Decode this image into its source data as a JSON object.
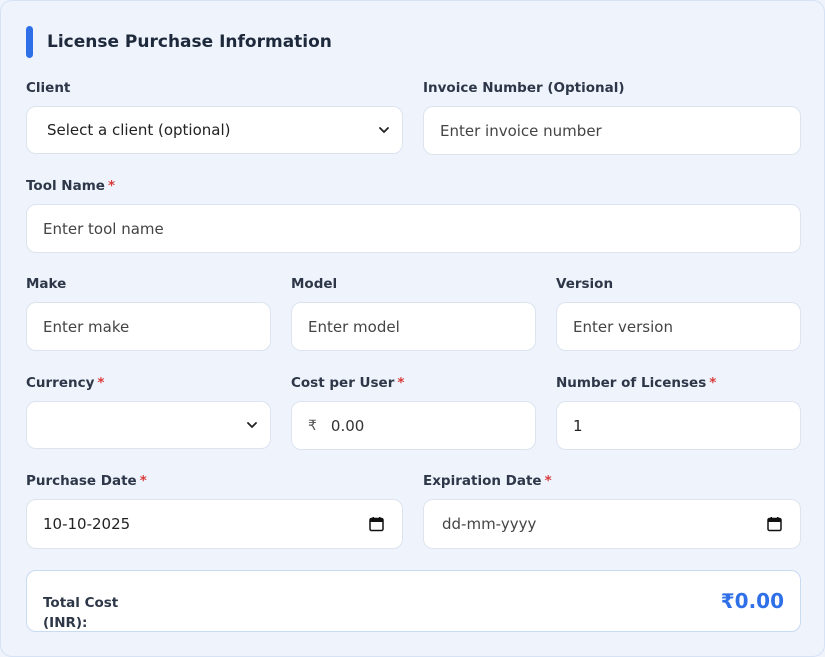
{
  "section": {
    "title": "License Purchase Information"
  },
  "client": {
    "label": "Client",
    "value": "Select a client (optional)"
  },
  "invoice": {
    "label": "Invoice Number (Optional)",
    "placeholder": "Enter invoice number"
  },
  "tool_name": {
    "label": "Tool Name",
    "required": "*",
    "placeholder": "Enter tool name"
  },
  "make": {
    "label": "Make",
    "placeholder": "Enter make"
  },
  "model": {
    "label": "Model",
    "placeholder": "Enter model"
  },
  "version": {
    "label": "Version",
    "placeholder": "Enter version"
  },
  "currency": {
    "label": "Currency",
    "required": "*",
    "value": ""
  },
  "cost_per_user": {
    "label": "Cost per User",
    "required": "*",
    "symbol": "₹",
    "value": "0.00"
  },
  "num_licenses": {
    "label": "Number of Licenses",
    "required": "*",
    "value": "1"
  },
  "purchase_date": {
    "label": "Purchase Date",
    "required": "*",
    "value": "10-10-2025"
  },
  "expiration_date": {
    "label": "Expiration Date",
    "required": "*",
    "placeholder": "dd-mm-yyyy"
  },
  "total": {
    "label": "Total Cost (INR):",
    "value": "₹0.00"
  },
  "colors": {
    "accent": "#2f6fe8",
    "required": "#d93b3b",
    "background": "#eef3fc"
  }
}
